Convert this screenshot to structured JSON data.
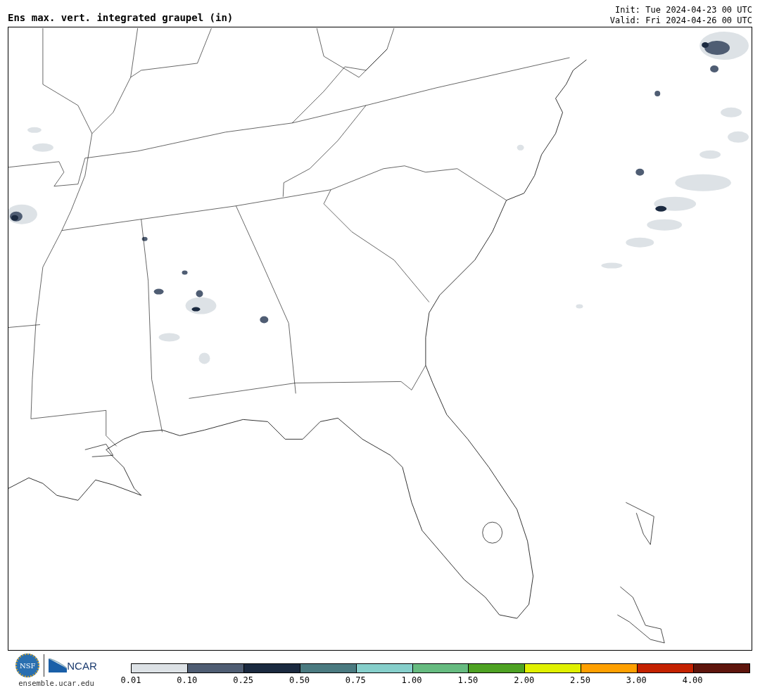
{
  "title": "Ens max. vert. integrated graupel (in)",
  "init": "Init: Tue 2024-04-23 00 UTC",
  "valid": "Valid: Fri 2024-04-26 00 UTC",
  "logos": {
    "nsf": "NSF",
    "ncar": "NCAR",
    "site": "ensemble.ucar.edu"
  },
  "legend": [
    {
      "label": "0.01",
      "color": "#dde2e6"
    },
    {
      "label": "0.10",
      "color": "#4f5d73"
    },
    {
      "label": "0.25",
      "color": "#1b2a40"
    },
    {
      "label": "0.50",
      "color": "#4a7a80"
    },
    {
      "label": "0.75",
      "color": "#86cfcb"
    },
    {
      "label": "1.00",
      "color": "#66bb80"
    },
    {
      "label": "1.50",
      "color": "#4ea224"
    },
    {
      "label": "2.00",
      "color": "#e0f000"
    },
    {
      "label": "2.50",
      "color": "#ffa000"
    },
    {
      "label": "3.00",
      "color": "#c42200"
    },
    {
      "label": "4.00",
      "color": "#5e150c"
    }
  ]
}
